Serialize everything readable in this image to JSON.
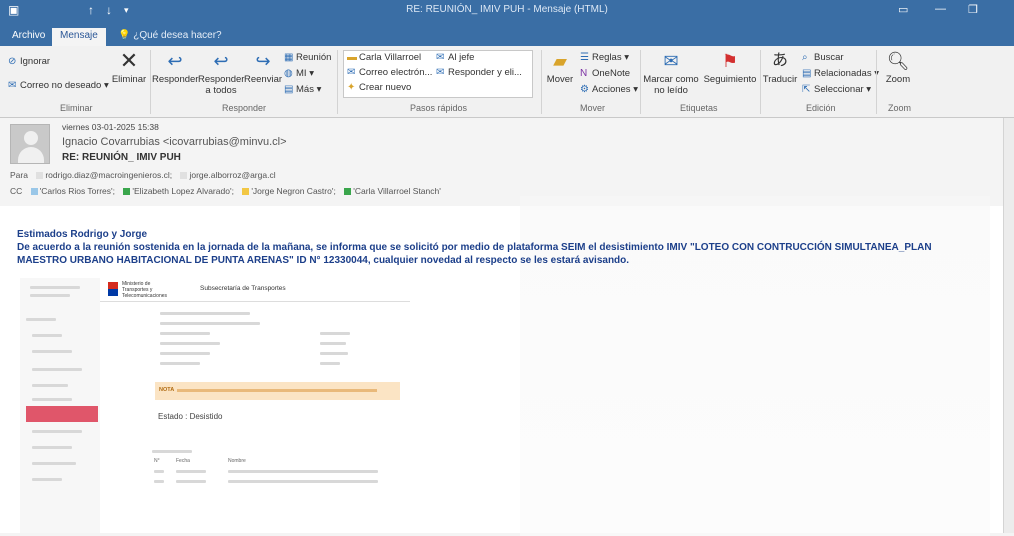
{
  "window": {
    "title": "RE: REUNIÓN_ IMIV PUH - Mensaje (HTML)"
  },
  "tabs": [
    {
      "label": "Archivo"
    },
    {
      "label": "Mensaje"
    }
  ],
  "tell_me": "¿Qué desea hacer?",
  "ribbon": {
    "eliminar": {
      "ignorar": "Ignorar",
      "correo_no_deseado": "Correo no deseado",
      "eliminar": "Eliminar",
      "group": "Eliminar"
    },
    "responder": {
      "responder": "Responder",
      "responder_todos": "Responder a todos",
      "reenviar": "Reenviar",
      "reunion": "Reunión",
      "mi": "MI",
      "mas": "Más",
      "group": "Responder"
    },
    "pasos_rapidos": {
      "items": [
        "Carla Villarroel",
        "Al jefe",
        "Correo electrón...",
        "Responder y eli...",
        "Crear nuevo"
      ],
      "group": "Pasos rápidos"
    },
    "mover": {
      "mover": "Mover",
      "reglas": "Reglas",
      "onenote": "OneNote",
      "acciones": "Acciones",
      "group": "Mover"
    },
    "etiquetas": {
      "marcar": "Marcar como no leído",
      "seguimiento": "Seguimiento",
      "group": "Etiquetas"
    },
    "edicion": {
      "traducir": "Traducir",
      "buscar": "Buscar",
      "relacionadas": "Relacionadas",
      "seleccionar": "Seleccionar",
      "group": "Edición"
    },
    "zoom": {
      "zoom": "Zoom",
      "group": "Zoom"
    }
  },
  "message": {
    "date": "viernes 03-01-2025 15:38",
    "sender": "Ignacio Covarrubias <icovarrubias@minvu.cl>",
    "subject": "RE: REUNIÓN_ IMIV PUH",
    "to_label": "Para",
    "to": [
      "rodrigo.diaz@macroingenieros.cl",
      "jorge.alborroz@arga.cl"
    ],
    "cc_label": "CC",
    "cc": [
      {
        "name": "'Carlos Rios Torres'",
        "color": "#9ac7e8"
      },
      {
        "name": "'Elizabeth Lopez Alvarado'",
        "color": "#3aa64c"
      },
      {
        "name": "'Jorge Negron Castro'",
        "color": "#f2c744"
      },
      {
        "name": "'Carla Villarroel Stanch'",
        "color": "#3aa64c"
      }
    ],
    "greeting": "Estimados Rodrigo y Jorge",
    "body": "De acuerdo a la reunión sostenida en la jornada de la mañana, se informa que se solicitó por medio de plataforma SEIM el desistimiento IMIV \"LOTEO CON CONTRUCCIÓN SIMULTANEA_PLAN MAESTRO URBANO HABITACIONAL DE PUNTA ARENAS\" ID N° 12330044, cualquier novedad al respecto se les estará avisando."
  },
  "embedded": {
    "ministry": "Ministerio de Transportes y Telecomunicaciones",
    "subsecretaria": "Subsecretaría de Transportes",
    "nota_label": "NOTA",
    "estado_label": "Estado",
    "estado_value": "Desistido",
    "hist_cols": [
      "N°",
      "Fecha",
      "Nombre"
    ]
  },
  "colors": {
    "titlebar": "#3a6ea5",
    "accent": "#2b5797",
    "body_text": "#1c3f8a"
  }
}
